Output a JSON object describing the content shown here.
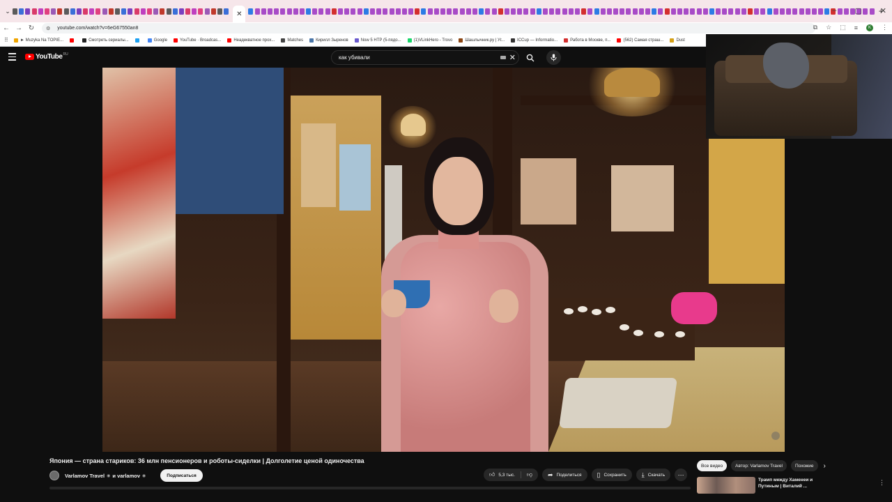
{
  "browser": {
    "url": "youtube.com/watch?v=6eG67550an8",
    "bookmarks": [
      {
        "label": "► Muzyka Na TOPIE...",
        "color": "#f0a500"
      },
      {
        "label": "",
        "color": "#ff0000"
      },
      {
        "label": "Смотреть сериалы...",
        "color": "#222222"
      },
      {
        "label": "",
        "color": "#1da1f2"
      },
      {
        "label": "Google",
        "color": "#4285f4"
      },
      {
        "label": "YouTube · Broadcas...",
        "color": "#ff0000"
      },
      {
        "label": "Неадекватное прох...",
        "color": "#ff0000"
      },
      {
        "label": "Matches",
        "color": "#444444"
      },
      {
        "label": "Кирилл Зыренов",
        "color": "#4a76a8"
      },
      {
        "label": "Now 5 HTP (5-пядо...",
        "color": "#6a5acd"
      },
      {
        "label": "(1)VLinkHero - Trovo",
        "color": "#19d66b"
      },
      {
        "label": "Шашлычник.ру | Уг...",
        "color": "#8b4513"
      },
      {
        "label": "ICCup — Informatio...",
        "color": "#333333"
      },
      {
        "label": "Работа в Москве, п...",
        "color": "#d32f2f"
      },
      {
        "label": "(562) Самая страш...",
        "color": "#ff0000"
      },
      {
        "label": "Dust",
        "color": "#d4a017"
      }
    ],
    "window_controls": [
      "–",
      "▢",
      "✕"
    ],
    "profile_initial": "K"
  },
  "youtube": {
    "wordmark": "YouTube",
    "region": "RU",
    "search": {
      "value": "как убивали"
    }
  },
  "video": {
    "title": "Япония — страна стариков: 36 млн пенсионеров и роботы-сиделки | Долголетие ценой одиночества",
    "channel": "Varlamov Travel",
    "channel_and": "и varlamov",
    "verified_mark": "◉",
    "subscribe_label": "Подписаться",
    "likes": "5,3 тыс.",
    "share_label": "Поделиться",
    "save_label": "Сохранить",
    "download_label": "Скачать"
  },
  "sidebar": {
    "chips": [
      {
        "label": "Все видео",
        "active": true
      },
      {
        "label": "Автор: Varlamov Travel",
        "active": false
      },
      {
        "label": "Похожие",
        "active": false
      }
    ],
    "recommendation": {
      "title_line1": "Трамп между Хаменеи и",
      "title_line2": "Путиным | Виталий ..."
    }
  }
}
